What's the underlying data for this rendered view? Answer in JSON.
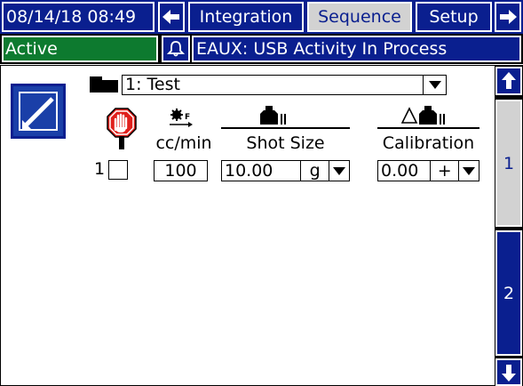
{
  "header": {
    "datetime": "08/14/18 08:49",
    "tabs": [
      {
        "label": "Integration"
      },
      {
        "label": "Sequence"
      },
      {
        "label": "Setup"
      }
    ]
  },
  "status": {
    "state": "Active",
    "message": "EAUX: USB Activity In Process"
  },
  "job": {
    "selected": "1: Test"
  },
  "columns": {
    "flow_unit": "cc/min",
    "shot_size": "Shot Size",
    "calibration": "Calibration"
  },
  "row": {
    "index": "1",
    "flow": "100",
    "shot_value": "10.00",
    "shot_unit": "g",
    "cal_value": "0.00",
    "cal_sign": "+"
  },
  "pager": {
    "page1": "1",
    "page2": "2"
  },
  "colors": {
    "navy": "#0a1f8f",
    "stop_red": "#e0201c",
    "active_tab": "#d2d2d2"
  }
}
